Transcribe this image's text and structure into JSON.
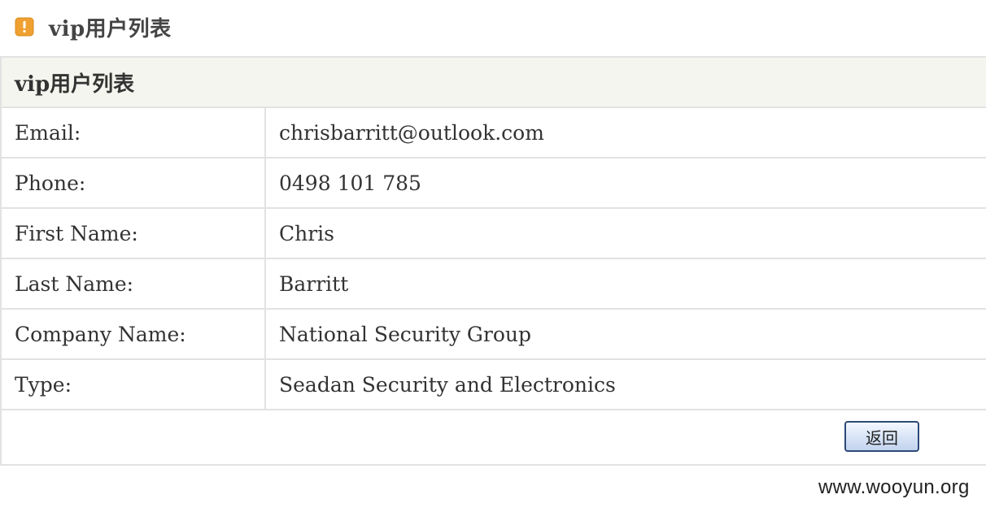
{
  "header": {
    "icon": "warning-icon",
    "title": "vip用户列表"
  },
  "panel": {
    "title": "vip用户列表",
    "rows": [
      {
        "label": "Email:",
        "value": "chrisbarritt@outlook.com"
      },
      {
        "label": "Phone:",
        "value": "0498 101 785"
      },
      {
        "label": "First Name:",
        "value": "Chris"
      },
      {
        "label": "Last Name:",
        "value": "Barritt"
      },
      {
        "label": "Company Name:",
        "value": "National Security Group"
      },
      {
        "label": "Type:",
        "value": "Seadan Security and Electronics"
      }
    ],
    "back_label": "返回"
  },
  "watermark": "www.wooyun.org",
  "colors": {
    "icon_orange": "#f0a030",
    "panel_head_bg": "#f5f5ef",
    "border": "#e2e2e2",
    "button_border": "#2c4a78"
  }
}
